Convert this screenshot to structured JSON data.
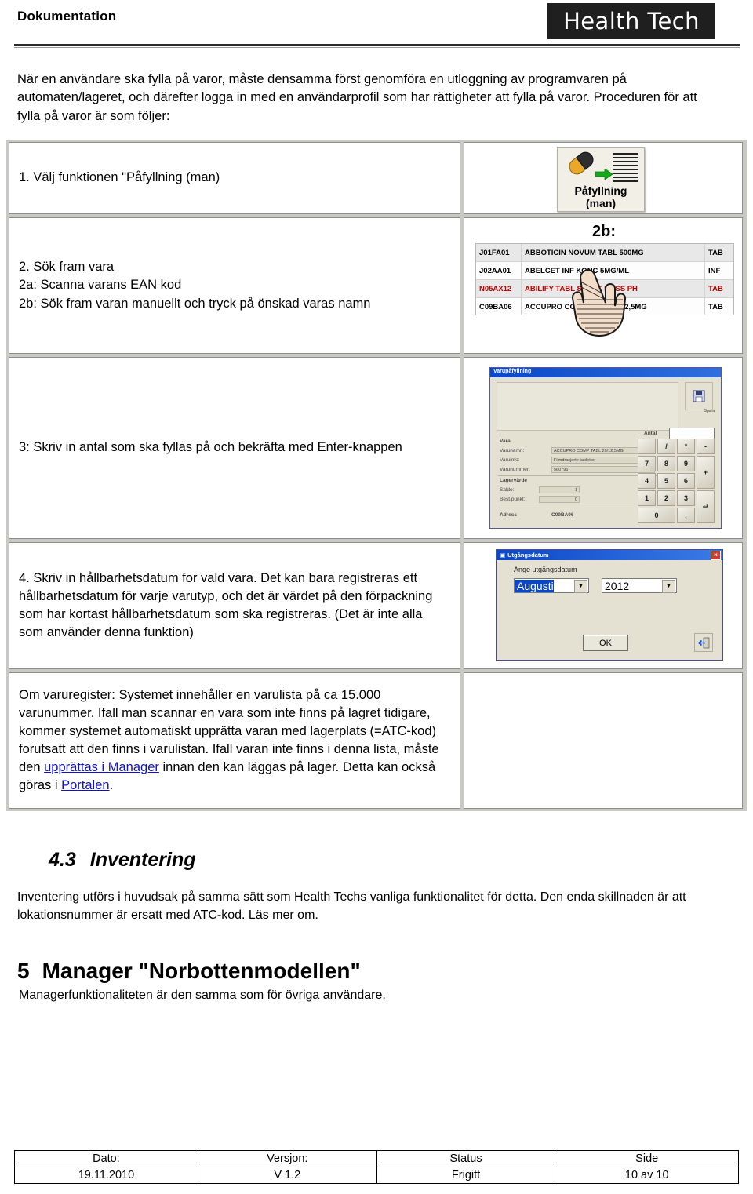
{
  "header": {
    "doc_kind": "Dokumentation",
    "logo_text": "Health Tech"
  },
  "intro": {
    "paragraph": "När en användare ska fylla på varor, måste densamma först genomföra en utloggning av programvaren på automaten/lageret, och därefter logga in med en användarprofil som har rättigheter att fylla på varor. Proceduren för att fylla på varor är som följer:"
  },
  "steps": [
    {
      "id": "step-1",
      "text": "1. Välj funktionen \"Påfyllning (man)",
      "figure": {
        "type": "button-icon",
        "icon_label_line1": "Påfyllning",
        "icon_label_line2": "(man)"
      }
    },
    {
      "id": "step-2",
      "text": "2. Sök fram vara\n2a: Scanna varans EAN kod\n2b: Sök fram varan manuellt och tryck på önskad varas namn",
      "figure": {
        "type": "product-table",
        "tag": "2b:",
        "columns": [
          "atc",
          "name",
          "form"
        ],
        "rows": [
          {
            "atc": "J01FA01",
            "name": "ABBOTICIN NOVUM TABL 500MG",
            "form": "TAB",
            "shaded": true,
            "red": false
          },
          {
            "atc": "J02AA01",
            "name": "ABELCET INF KONC 5MG/ML",
            "form": "INF",
            "shaded": false,
            "red": false
          },
          {
            "atc": "N05AX12",
            "name": "ABILIFY TABL SMÄLT DOSS PH",
            "form": "TAB",
            "shaded": true,
            "red": true
          },
          {
            "atc": "C09BA06",
            "name": "ACCUPRO COMP TABL 20/12,5MG",
            "form": "TAB",
            "shaded": false,
            "red": false
          }
        ]
      }
    },
    {
      "id": "step-3",
      "text": "3: Skriv in antal som ska fyllas på och bekräfta med Enter-knappen",
      "figure": {
        "type": "dialog-varupafyllning",
        "title": "Varupåfyllning",
        "save_label": "Spara",
        "group_vara": "Vara",
        "label_varunamn": "Varunamn:",
        "label_varuinfo": "Varuinfo:",
        "label_varunummer": "Varunummer:",
        "value_varunamn": "ACCUPRO COMP TABL 20/12,5MG",
        "value_varuinfo": "Filmdrasjerte tabletter",
        "value_varunummer": "560796",
        "group_lagervarde": "Lagervärde",
        "label_saldo": "Saldo:",
        "label_bestpunkt": "Best.punkt:",
        "value_saldo": "1",
        "value_bestpunkt": "0",
        "label_adress": "Adress",
        "value_adress": "C09BA06",
        "label_antal": "Antal",
        "value_antal": "",
        "keypad": [
          "",
          "/",
          "*",
          "-",
          "7",
          "8",
          "9",
          "+",
          "4",
          "5",
          "6",
          "1",
          "2",
          "3",
          "↵",
          "0",
          "."
        ]
      }
    },
    {
      "id": "step-4",
      "text": "4. Skriv in hållbarhetsdatum for vald vara. Det kan bara registreras ett hållbarhetsdatum för varje varutyp, och det är värdet på den förpackning som har kortast hållbarhetsdatum som ska registreras. (Det är inte alla som använder denna funktion)",
      "figure": {
        "type": "dialog-utgangsdatum",
        "title": "Utgångsdatum",
        "prompt": "Ange utgångsdatum",
        "month_value": "Augusti",
        "year_value": "2012",
        "ok_label": "OK"
      }
    },
    {
      "id": "step-5",
      "text_parts": [
        {
          "t": "Om varuregister: Systemet innehåller en varulista på ca 15.000 varunummer. Ifall man scannar en vara som inte finns på lagret tidigare, kommer systemet automatiskt upprätta varan med lagerplats (=ATC-kod) forutsatt att den finns i varulistan. Ifall varan inte finns i denna lista, måste den ",
          "link": false
        },
        {
          "t": "upprättas i Manager",
          "link": true
        },
        {
          "t": " innan den kan läggas på lager. Detta kan också göras i ",
          "link": false
        },
        {
          "t": "Portalen",
          "link": true
        },
        {
          "t": ".",
          "link": false
        }
      ],
      "figure": {
        "type": "empty"
      }
    }
  ],
  "section_43": {
    "number": "4.3",
    "title": "Inventering",
    "paragraph": "Inventering utförs i huvudsak på samma sätt som Health Techs vanliga funktionalitet för detta. Den enda skillnaden är att lokationsnummer är ersatt med ATC-kod. Läs mer om."
  },
  "section_5": {
    "number": "5",
    "title": "Manager \"Norbottenmodellen\"",
    "paragraph": "Managerfunktionaliteten är den samma som för övriga användare."
  },
  "footer": {
    "headers": [
      "Dato:",
      "Versjon:",
      "Status",
      "Side"
    ],
    "values": [
      "19.11.2010",
      "V 1.2",
      "Frigitt",
      "10 av 10"
    ]
  },
  "colors": {
    "logo_bg": "#1f1f1f",
    "link": "#1111cc",
    "red_row": "#c00000",
    "dialog_titlebar": "#0a46c8",
    "dialog_face": "#e4e0d2"
  }
}
